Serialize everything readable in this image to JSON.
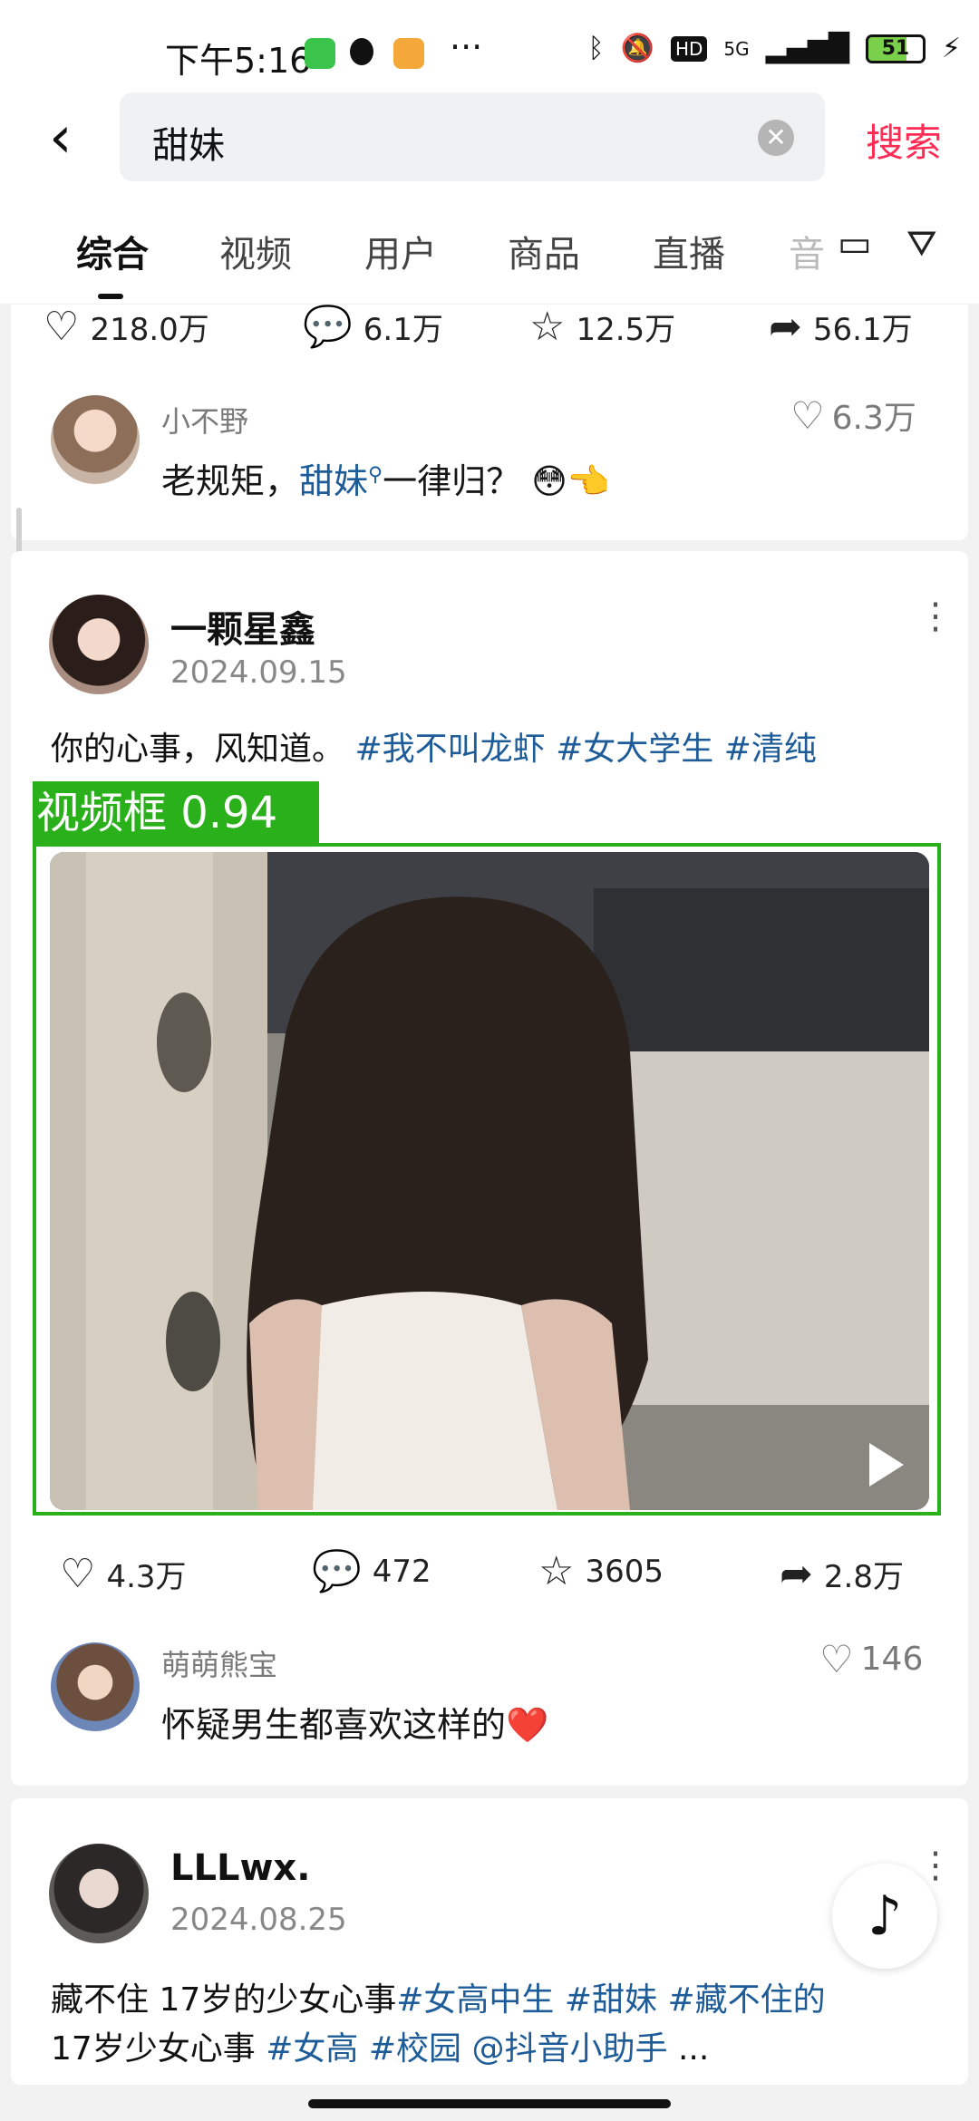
{
  "status_bar": {
    "time": "下午5:16",
    "network": "5G",
    "hd": "HD",
    "battery": "51"
  },
  "search": {
    "value": "甜妹",
    "submit_label": "搜索"
  },
  "tabs": [
    {
      "label": "综合"
    },
    {
      "label": "视频"
    },
    {
      "label": "用户"
    },
    {
      "label": "商品"
    },
    {
      "label": "直播"
    },
    {
      "label": "音"
    }
  ],
  "post1": {
    "stats": {
      "likes": "218.0万",
      "comments": "6.1万",
      "favorites": "12.5万",
      "shares": "56.1万"
    },
    "comment": {
      "user": "小不野",
      "text_prefix": "老规矩，",
      "link": "甜妹",
      "text_suffix": "一律归？ 😳👈",
      "likes": "6.3万"
    }
  },
  "post2": {
    "author": "一颗星鑫",
    "date": "2024.09.15",
    "desc_prefix": "你的心事，风知道。",
    "hashtags": [
      "#我不叫龙虾",
      "#女大学生",
      "#清纯"
    ],
    "detection_label": "视频框 0.94",
    "stats": {
      "likes": "4.3万",
      "comments": "472",
      "favorites": "3605",
      "shares": "2.8万"
    },
    "comment": {
      "user": "萌萌熊宝",
      "text": "怀疑男生都喜欢这样的❤️",
      "likes": "146"
    }
  },
  "post3": {
    "author": "LLLwx.",
    "date": "2024.08.25",
    "desc_line1_prefix": "藏不住 17岁的少女心事",
    "desc_line1_tags": [
      "#女高中生",
      "#甜妹",
      "#藏不住的"
    ],
    "desc_line2_prefix": "17岁少女心事",
    "desc_line2_tags": [
      "#女高",
      "#校园",
      "@抖音小助手"
    ],
    "desc_line2_suffix": "..."
  }
}
